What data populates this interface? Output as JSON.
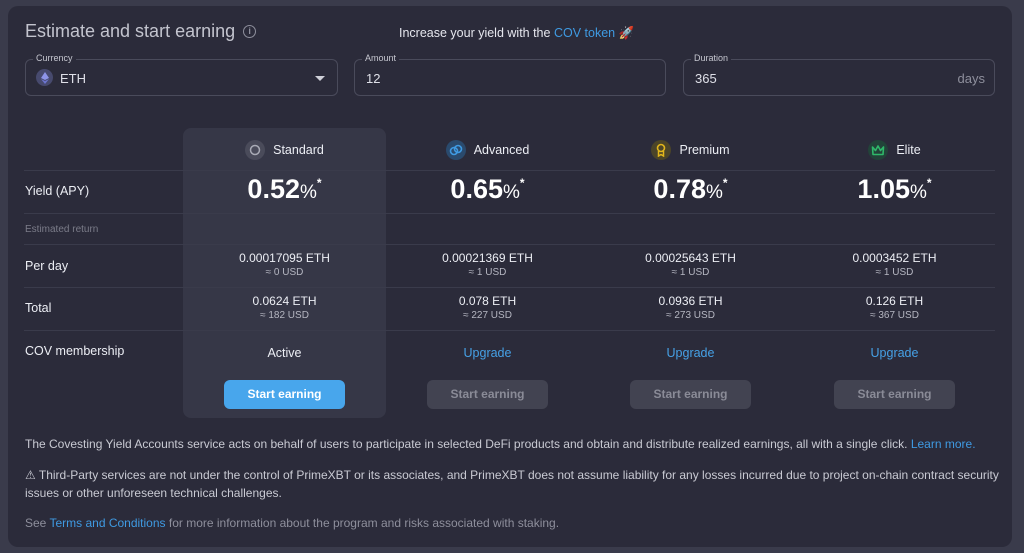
{
  "header": {
    "title": "Estimate and start earning",
    "info_icon": "info-circle-icon",
    "promo_prefix": "Increase your yield with the ",
    "promo_link": "COV token",
    "promo_emoji": "🚀"
  },
  "form": {
    "currency": {
      "label": "Currency",
      "value": "ETH",
      "icon": "ethereum-icon"
    },
    "amount": {
      "label": "Amount",
      "value": "12"
    },
    "duration": {
      "label": "Duration",
      "value": "365",
      "suffix": "days"
    }
  },
  "table": {
    "row_labels": {
      "yield": "Yield (APY)",
      "estimated_return": "Estimated return",
      "per_day": "Per day",
      "total": "Total",
      "membership": "COV membership"
    },
    "tiers": [
      {
        "name": "Standard",
        "icon": "circle-icon",
        "icon_color": "#a9aab5",
        "apy": "0.52",
        "apy_unit": "%",
        "apy_mark": "*",
        "per_day_eth": "0.00017095 ETH",
        "per_day_usd": "≈ 0 USD",
        "total_eth": "0.0624 ETH",
        "total_usd": "≈ 182 USD",
        "membership": "Active",
        "button": "Start earning",
        "selected": true
      },
      {
        "name": "Advanced",
        "icon": "link-rings-icon",
        "icon_color": "#3f9ae2",
        "apy": "0.65",
        "apy_unit": "%",
        "apy_mark": "*",
        "per_day_eth": "0.00021369 ETH",
        "per_day_usd": "≈ 1 USD",
        "total_eth": "0.078 ETH",
        "total_usd": "≈ 227 USD",
        "membership": "Upgrade",
        "button": "Start earning",
        "selected": false
      },
      {
        "name": "Premium",
        "icon": "medal-icon",
        "icon_color": "#e2b61c",
        "apy": "0.78",
        "apy_unit": "%",
        "apy_mark": "*",
        "per_day_eth": "0.00025643 ETH",
        "per_day_usd": "≈ 1 USD",
        "total_eth": "0.0936 ETH",
        "total_usd": "≈ 273 USD",
        "membership": "Upgrade",
        "button": "Start earning",
        "selected": false
      },
      {
        "name": "Elite",
        "icon": "crown-icon",
        "icon_color": "#2fb86a",
        "apy": "1.05",
        "apy_unit": "%",
        "apy_mark": "*",
        "per_day_eth": "0.0003452 ETH",
        "per_day_usd": "≈ 1 USD",
        "total_eth": "0.126 ETH",
        "total_usd": "≈ 367 USD",
        "membership": "Upgrade",
        "button": "Start earning",
        "selected": false
      }
    ]
  },
  "footer": {
    "description": "The Covesting Yield Accounts service acts on behalf of users to participate in selected DeFi products and obtain and distribute realized earnings, all with a single click. ",
    "learn_more": "Learn more",
    "learn_more_suffix": ".",
    "warning_icon": "⚠",
    "warning": " Third-Party services are not under the control of PrimeXBT or its associates, and PrimeXBT does not assume liability for any losses incurred due to project on-chain contract security issues or other unforeseen technical challenges.",
    "terms_prefix": "See ",
    "terms_link": "Terms and Conditions",
    "terms_suffix": " for more information about the program and risks associated with staking."
  }
}
